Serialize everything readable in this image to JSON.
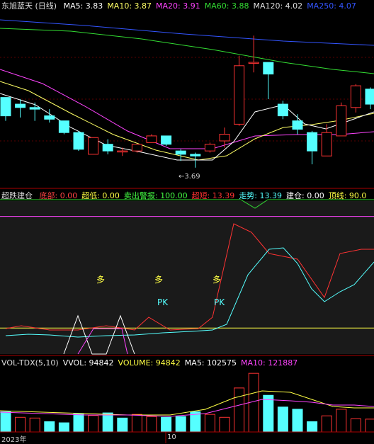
{
  "main": {
    "stock_name": "东旭蓝天 (日线)",
    "ma": [
      {
        "label": "MA5: 3.83",
        "color": "#ffffff"
      },
      {
        "label": "MA10: 3.87",
        "color": "#ffff66"
      },
      {
        "label": "MA20: 3.91",
        "color": "#ff44ff"
      },
      {
        "label": "MA60: 3.88",
        "color": "#33dd33"
      },
      {
        "label": "MA120: 4.02",
        "color": "#dddddd"
      },
      {
        "label": "MA250: 4.07",
        "color": "#3355ff"
      }
    ],
    "low_marker": "3.69"
  },
  "indicator": {
    "name": "超跌建仓",
    "items": [
      {
        "label": "底部: 0.00",
        "color": "#ff4444"
      },
      {
        "label": "超低: 0.00",
        "color": "#ffff44"
      },
      {
        "label": "卖出警报: 100.00",
        "color": "#44ff44"
      },
      {
        "label": "超短: 13.39",
        "color": "#ff3333"
      },
      {
        "label": "走势: 13.39",
        "color": "#55ffff"
      },
      {
        "label": "建仓: 0.00",
        "color": "#ffffff"
      },
      {
        "label": "顶线: 90.0",
        "color": "#ffff44"
      }
    ],
    "tags": [
      {
        "text": "多",
        "kind": "duo"
      },
      {
        "text": "多",
        "kind": "duo"
      },
      {
        "text": "多",
        "kind": "duo"
      },
      {
        "text": "PK",
        "kind": "pk"
      },
      {
        "text": "PK",
        "kind": "pk"
      }
    ]
  },
  "volume": {
    "items": [
      {
        "label": "VOL-TDX(5,10)",
        "color": "#dddddd"
      },
      {
        "label": "VVOL: 94842",
        "color": "#ffffff"
      },
      {
        "label": "VOLUME: 94842",
        "color": "#ffff44"
      },
      {
        "label": "MA5: 102575",
        "color": "#ffffff"
      },
      {
        "label": "MA10: 121887",
        "color": "#ff44ff"
      }
    ],
    "x_labels": [
      "2023年",
      "10"
    ]
  },
  "chart_data": {
    "type": "candlestick",
    "candles": [
      {
        "o": 4.11,
        "c": 4.0,
        "h": 4.11,
        "l": 3.97
      },
      {
        "o": 4.07,
        "c": 4.05,
        "h": 4.1,
        "l": 3.99
      },
      {
        "o": 4.05,
        "c": 4.04,
        "h": 4.08,
        "l": 3.97
      },
      {
        "o": 4.0,
        "c": 3.98,
        "h": 4.04,
        "l": 3.96
      },
      {
        "o": 3.97,
        "c": 3.9,
        "h": 3.97,
        "l": 3.89
      },
      {
        "o": 3.9,
        "c": 3.8,
        "h": 3.91,
        "l": 3.79
      },
      {
        "o": 3.77,
        "c": 3.87,
        "h": 3.87,
        "l": 3.77
      },
      {
        "o": 3.83,
        "c": 3.79,
        "h": 3.86,
        "l": 3.77
      },
      {
        "o": 3.79,
        "c": 3.79,
        "h": 3.81,
        "l": 3.76
      },
      {
        "o": 3.79,
        "c": 3.83,
        "h": 3.83,
        "l": 3.78
      },
      {
        "o": 3.84,
        "c": 3.88,
        "h": 3.89,
        "l": 3.84
      },
      {
        "o": 3.88,
        "c": 3.83,
        "h": 3.88,
        "l": 3.82
      },
      {
        "o": 3.79,
        "c": 3.77,
        "h": 3.8,
        "l": 3.73
      },
      {
        "o": 3.77,
        "c": 3.76,
        "h": 3.78,
        "l": 3.69
      },
      {
        "o": 3.79,
        "c": 3.83,
        "h": 3.84,
        "l": 3.78
      },
      {
        "o": 3.85,
        "c": 3.89,
        "h": 3.93,
        "l": 3.81
      },
      {
        "o": 3.95,
        "c": 4.3,
        "h": 4.36,
        "l": 3.94
      },
      {
        "o": 4.32,
        "c": 4.32,
        "h": 4.48,
        "l": 4.26
      },
      {
        "o": 4.32,
        "c": 4.25,
        "h": 4.32,
        "l": 4.1
      },
      {
        "o": 4.07,
        "c": 4.0,
        "h": 4.09,
        "l": 3.98
      },
      {
        "o": 3.97,
        "c": 3.92,
        "h": 4.01,
        "l": 3.89
      },
      {
        "o": 3.9,
        "c": 3.79,
        "h": 3.91,
        "l": 3.71
      },
      {
        "o": 3.76,
        "c": 3.9,
        "h": 3.95,
        "l": 3.76
      },
      {
        "o": 3.88,
        "c": 4.06,
        "h": 4.08,
        "l": 3.88
      },
      {
        "o": 4.05,
        "c": 4.18,
        "h": 4.19,
        "l": 4.02
      },
      {
        "o": 4.16,
        "c": 4.07,
        "h": 4.17,
        "l": 4.04
      }
    ],
    "volumes": [
      55,
      40,
      38,
      28,
      25,
      50,
      45,
      52,
      38,
      48,
      42,
      40,
      42,
      55,
      48,
      40,
      120,
      160,
      100,
      68,
      62,
      28,
      44,
      62,
      36,
      35
    ],
    "volume_colors": [
      "c",
      "r",
      "r",
      "c",
      "c",
      "c",
      "r",
      "c",
      "c",
      "r",
      "r",
      "c",
      "c",
      "c",
      "r",
      "r",
      "r",
      "r",
      "c",
      "c",
      "c",
      "c",
      "r",
      "r",
      "r",
      "r"
    ]
  }
}
